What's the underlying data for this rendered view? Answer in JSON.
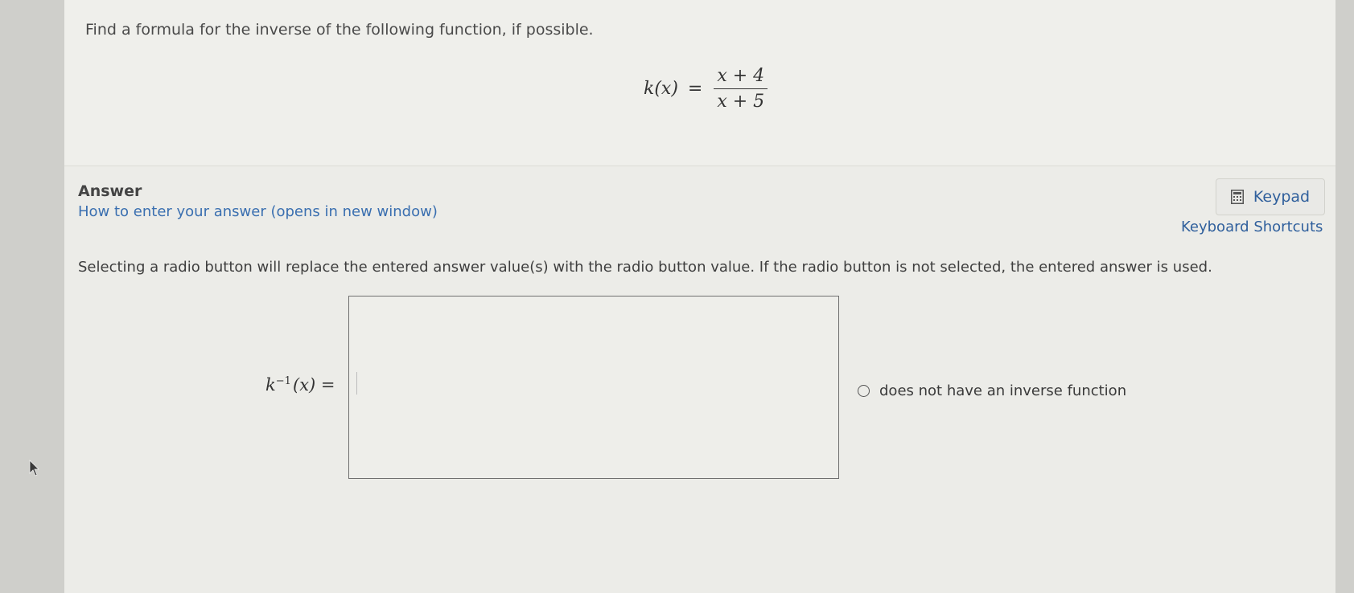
{
  "question": {
    "prompt": "Find a formula for the inverse of the following function, if possible.",
    "function_lhs": "k(x)",
    "equals": "=",
    "numerator": "x + 4",
    "denominator": "x + 5"
  },
  "answer": {
    "label": "Answer",
    "howto_link": "How to enter your answer (opens in new window)",
    "keypad_label": "Keypad",
    "keypad_icon": "calculator-icon",
    "shortcuts_link": "Keyboard Shortcuts",
    "instructions": "Selecting a radio button will replace the entered answer value(s) with the radio button value. If the radio button is not selected, the entered answer is used.",
    "lhs_base": "k",
    "lhs_sup": "−1",
    "lhs_arg": "(x) =",
    "input_value": "",
    "radio_label": "does not have an inverse function",
    "radio_selected": false
  },
  "colors": {
    "link": "#2f5f9c",
    "page_background": "#ecece8"
  }
}
